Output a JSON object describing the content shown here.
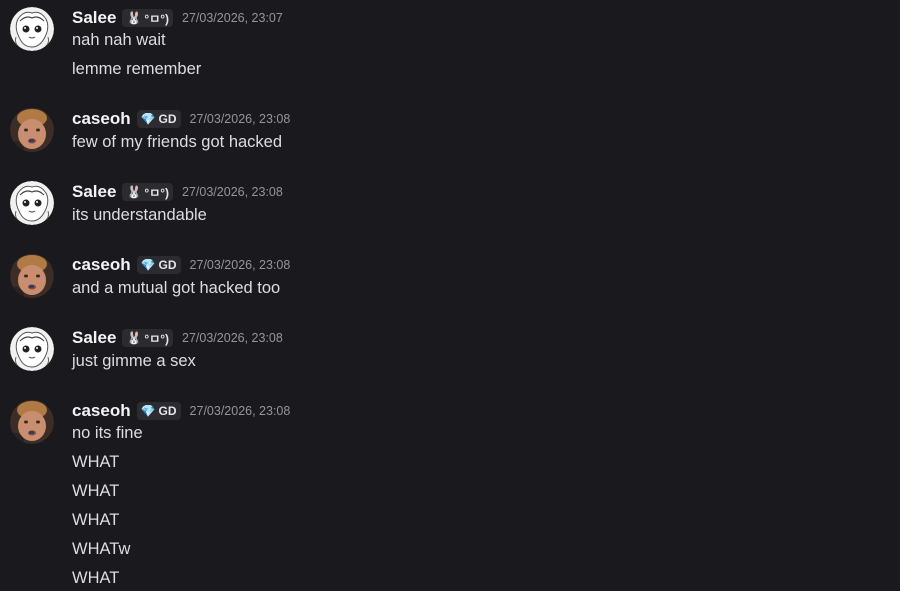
{
  "users": {
    "salee": {
      "name": "Salee",
      "tag_icon": "bunny-icon",
      "tag_text": "°ㅁ°)"
    },
    "caseoh": {
      "name": "caseoh",
      "tag_icon": "gem-icon",
      "tag_text": "GD"
    }
  },
  "messages": [
    {
      "user": "Salee",
      "tag": "°ㅁ°)",
      "timestamp": "27/03/2026, 23:07",
      "lines": [
        "nah nah wait",
        "lemme remember"
      ]
    },
    {
      "user": "caseoh",
      "tag": "GD",
      "timestamp": "27/03/2026, 23:08",
      "lines": [
        "few of my friends got hacked"
      ]
    },
    {
      "user": "Salee",
      "tag": "°ㅁ°)",
      "timestamp": "27/03/2026, 23:08",
      "lines": [
        "its understandable"
      ]
    },
    {
      "user": "caseoh",
      "tag": "GD",
      "timestamp": "27/03/2026, 23:08",
      "lines": [
        "and a mutual got hacked too"
      ]
    },
    {
      "user": "Salee",
      "tag": "°ㅁ°)",
      "timestamp": "27/03/2026, 23:08",
      "lines": [
        "just gimme a sex"
      ]
    },
    {
      "user": "caseoh",
      "tag": "GD",
      "timestamp": "27/03/2026, 23:08",
      "lines": [
        "no its fine",
        "WHAT",
        "WHAT",
        "WHAT",
        "WHATw",
        "WHAT"
      ]
    }
  ],
  "colors": {
    "background": "#1a1a1e",
    "username": "#f2f3f5",
    "message_text": "#dbdee1",
    "timestamp": "#94959c",
    "tag_background": "#2b2b30"
  }
}
